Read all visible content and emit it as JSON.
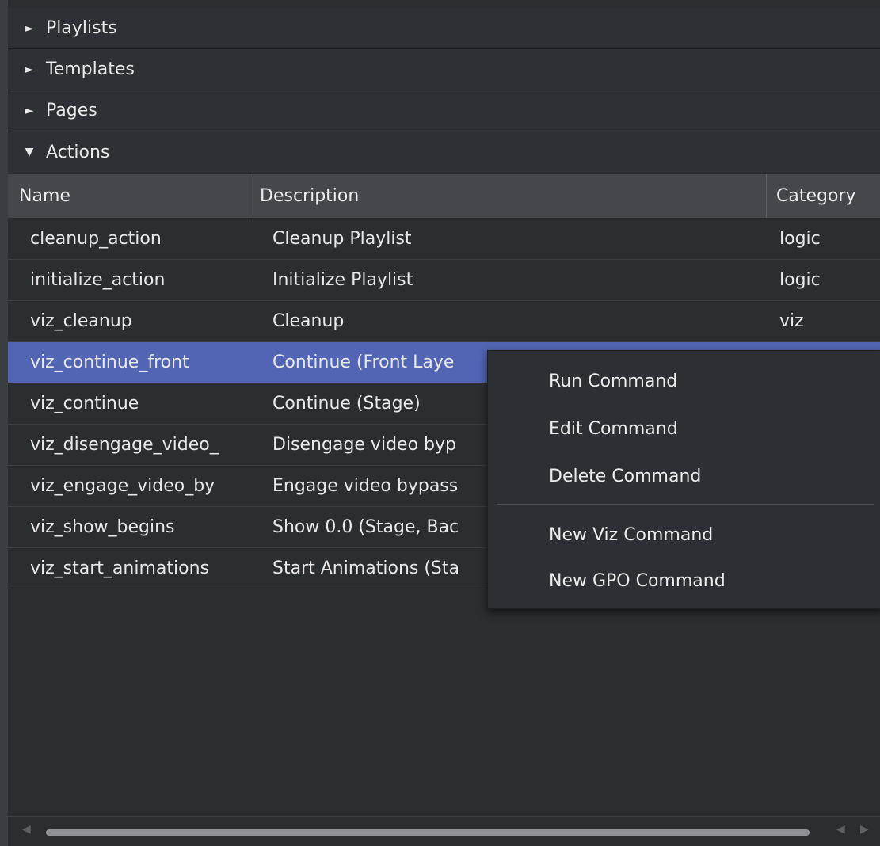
{
  "sections": [
    {
      "label": "Playlists",
      "expanded": false
    },
    {
      "label": "Templates",
      "expanded": false
    },
    {
      "label": "Pages",
      "expanded": false
    },
    {
      "label": "Actions",
      "expanded": true
    }
  ],
  "icons": {
    "collapsed": "triangle-right-icon",
    "expanded": "triangle-down-icon"
  },
  "table": {
    "headers": {
      "name": "Name",
      "description": "Description",
      "category": "Category"
    },
    "rows": [
      {
        "name": "cleanup_action",
        "description": "Cleanup Playlist",
        "category": "logic"
      },
      {
        "name": "initialize_action",
        "description": "Initialize Playlist",
        "category": "logic"
      },
      {
        "name": "viz_cleanup",
        "description": "Cleanup",
        "category": "viz"
      },
      {
        "name": "viz_continue_front",
        "description": "Continue (Front Laye",
        "category": "",
        "selected": true
      },
      {
        "name": "viz_continue",
        "description": "Continue (Stage)",
        "category": ""
      },
      {
        "name": "viz_disengage_video_",
        "description": "Disengage video byp",
        "category": ""
      },
      {
        "name": "viz_engage_video_by",
        "description": "Engage video bypass",
        "category": ""
      },
      {
        "name": "viz_show_begins",
        "description": "Show 0.0 (Stage, Bac",
        "category": ""
      },
      {
        "name": "viz_start_animations",
        "description": "Start Animations (Sta",
        "category": ""
      }
    ]
  },
  "context_menu": {
    "items": [
      "Run Command",
      "Edit Command",
      "Delete Command",
      "New Viz Command",
      "New GPO Command"
    ]
  },
  "colors": {
    "selection": "#5265b4",
    "background": "#2b2e31",
    "header": "#44484d"
  }
}
